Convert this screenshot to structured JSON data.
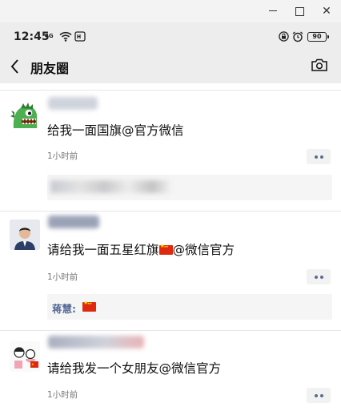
{
  "window": {
    "close_glyph": "✕"
  },
  "status_bar": {
    "time": "12:45",
    "network_label": "4G",
    "battery": "90"
  },
  "nav": {
    "title": "朋友圈"
  },
  "posts": [
    {
      "text": "给我一面国旗@官方微信",
      "time": "1小时前"
    },
    {
      "text_before_flag": "请给我一面五星红旗",
      "text_after_flag": "@微信官方",
      "time": "1小时前",
      "comment_author": "蒋慧:"
    },
    {
      "text": "请给我发一个女朋友@微信官方",
      "time": "1小时前"
    }
  ],
  "colors": {
    "link": "#576b95",
    "flag_red": "#de2910",
    "flag_star": "#ffde00"
  }
}
